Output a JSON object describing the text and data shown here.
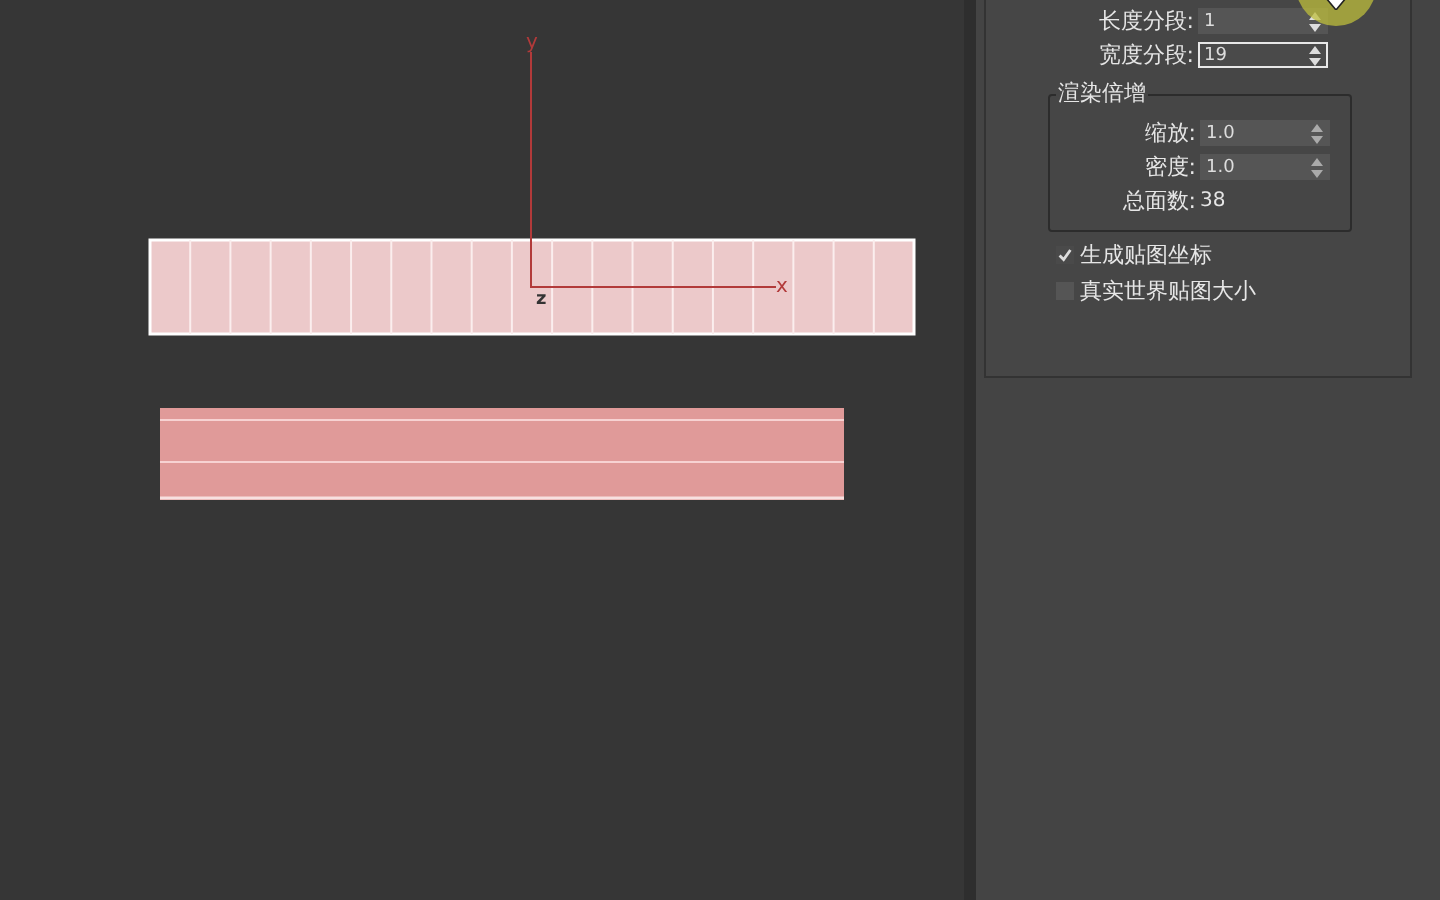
{
  "viewport": {
    "axis_labels": {
      "y": "y",
      "x": "x",
      "z": "z"
    }
  },
  "parameters": {
    "fields": [
      {
        "label": "长度分段:",
        "value": "1",
        "focused": false
      },
      {
        "label": "宽度分段:",
        "value": "19",
        "focused": true
      }
    ],
    "render_multipliers": {
      "title": "渲染倍增",
      "fields": [
        {
          "label": "缩放:",
          "value": "1.0"
        },
        {
          "label": "密度:",
          "value": "1.0"
        }
      ],
      "total_label": "总面数:",
      "total_value": "38"
    },
    "checkboxes": [
      {
        "label": "生成贴图坐标",
        "checked": true
      },
      {
        "label": "真实世界贴图大小",
        "checked": false
      }
    ]
  }
}
